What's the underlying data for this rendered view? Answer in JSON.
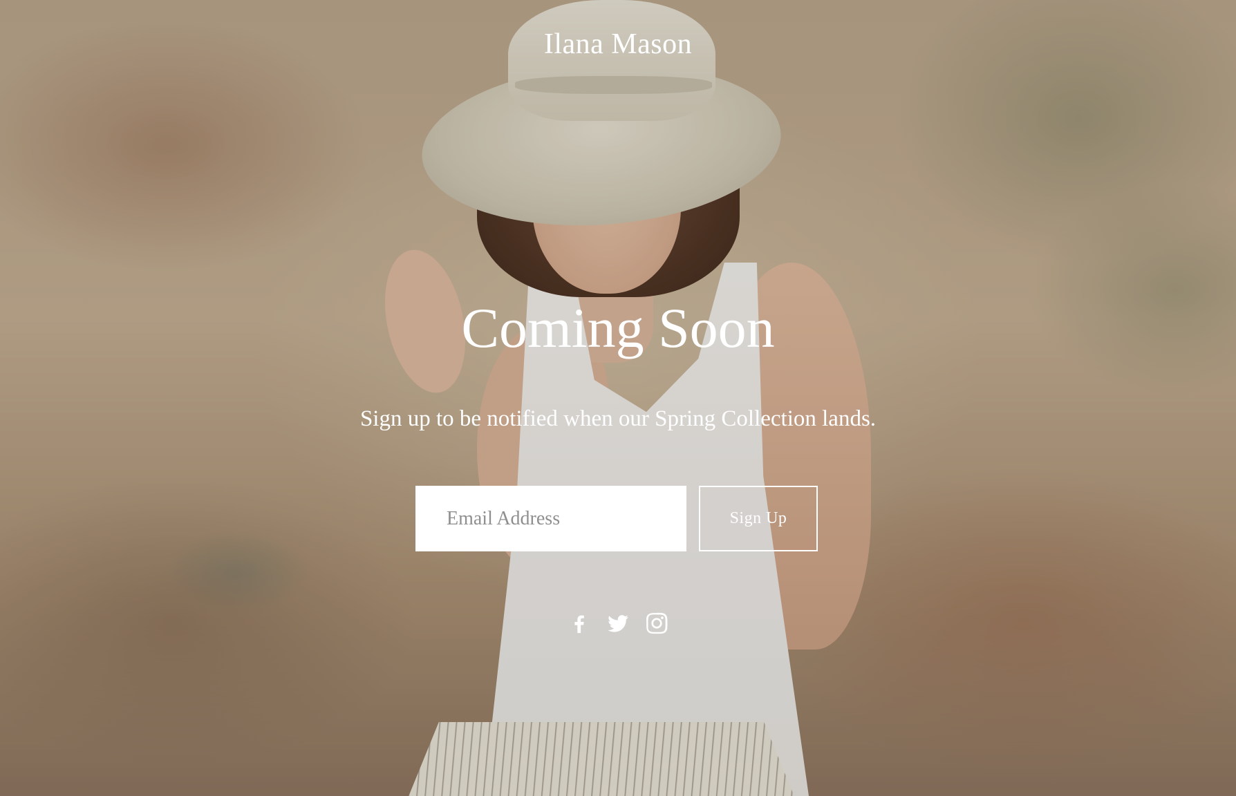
{
  "site": {
    "brand": "Ilana Mason"
  },
  "hero": {
    "headline": "Coming Soon",
    "subline": "Sign up to be notified when our Spring Collection lands."
  },
  "form": {
    "email_placeholder": "Email Address",
    "email_value": "",
    "submit_label": "Sign Up"
  },
  "social": [
    {
      "name": "facebook",
      "icon": "facebook-icon"
    },
    {
      "name": "twitter",
      "icon": "twitter-icon"
    },
    {
      "name": "instagram",
      "icon": "instagram-icon"
    }
  ],
  "colors": {
    "text": "#ffffff",
    "input_bg": "#ffffff",
    "placeholder": "#8f8f8f"
  }
}
